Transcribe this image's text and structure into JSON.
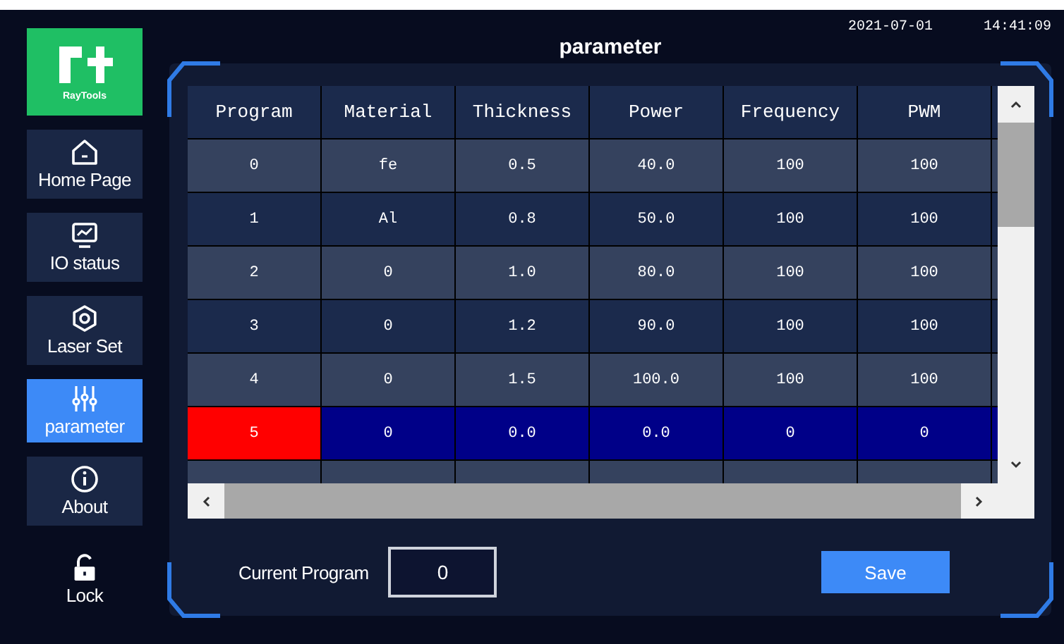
{
  "sidebar": {
    "logo_text": "RayTools",
    "items": [
      {
        "label": "Home Page",
        "selected": false
      },
      {
        "label": "IO status",
        "selected": false
      },
      {
        "label": "Laser Set",
        "selected": false
      },
      {
        "label": "parameter",
        "selected": true
      },
      {
        "label": "About",
        "selected": false
      }
    ],
    "lock": {
      "label": "Lock"
    }
  },
  "header": {
    "title": "parameter",
    "date": "2021-07-01",
    "time": "14:41:09"
  },
  "table": {
    "columns": [
      "Program",
      "Material",
      "Thickness",
      "Power",
      "Frequency",
      "PWM"
    ],
    "rows": [
      {
        "cells": [
          "0",
          "fe",
          "0.5",
          "40.0",
          "100",
          "100"
        ],
        "selected": false
      },
      {
        "cells": [
          "1",
          "Al",
          "0.8",
          "50.0",
          "100",
          "100"
        ],
        "selected": false
      },
      {
        "cells": [
          "2",
          "0",
          "1.0",
          "80.0",
          "100",
          "100"
        ],
        "selected": false
      },
      {
        "cells": [
          "3",
          "0",
          "1.2",
          "90.0",
          "100",
          "100"
        ],
        "selected": false
      },
      {
        "cells": [
          "4",
          "0",
          "1.5",
          "100.0",
          "100",
          "100"
        ],
        "selected": false
      },
      {
        "cells": [
          "5",
          "0",
          "0.0",
          "0.0",
          "0",
          "0"
        ],
        "selected": true
      }
    ]
  },
  "footer": {
    "current_label": "Current Program",
    "current_value": "0",
    "save": "Save"
  }
}
